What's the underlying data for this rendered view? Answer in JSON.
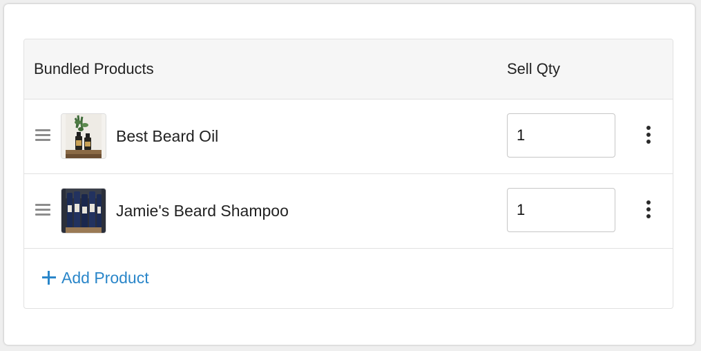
{
  "bundle_table": {
    "header": {
      "products_label": "Bundled Products",
      "qty_label": "Sell Qty"
    },
    "rows": [
      {
        "name": "Best Beard Oil",
        "qty": "1",
        "thumbnail_icon": "beard-oil-bottles-photo"
      },
      {
        "name": "Jamie's Beard Shampoo",
        "qty": "1",
        "thumbnail_icon": "shampoo-bottles-photo"
      }
    ],
    "add_product_label": "Add Product"
  },
  "colors": {
    "link": "#2a86c9",
    "header_bg": "#f6f6f6",
    "border": "#e1e1e1"
  }
}
